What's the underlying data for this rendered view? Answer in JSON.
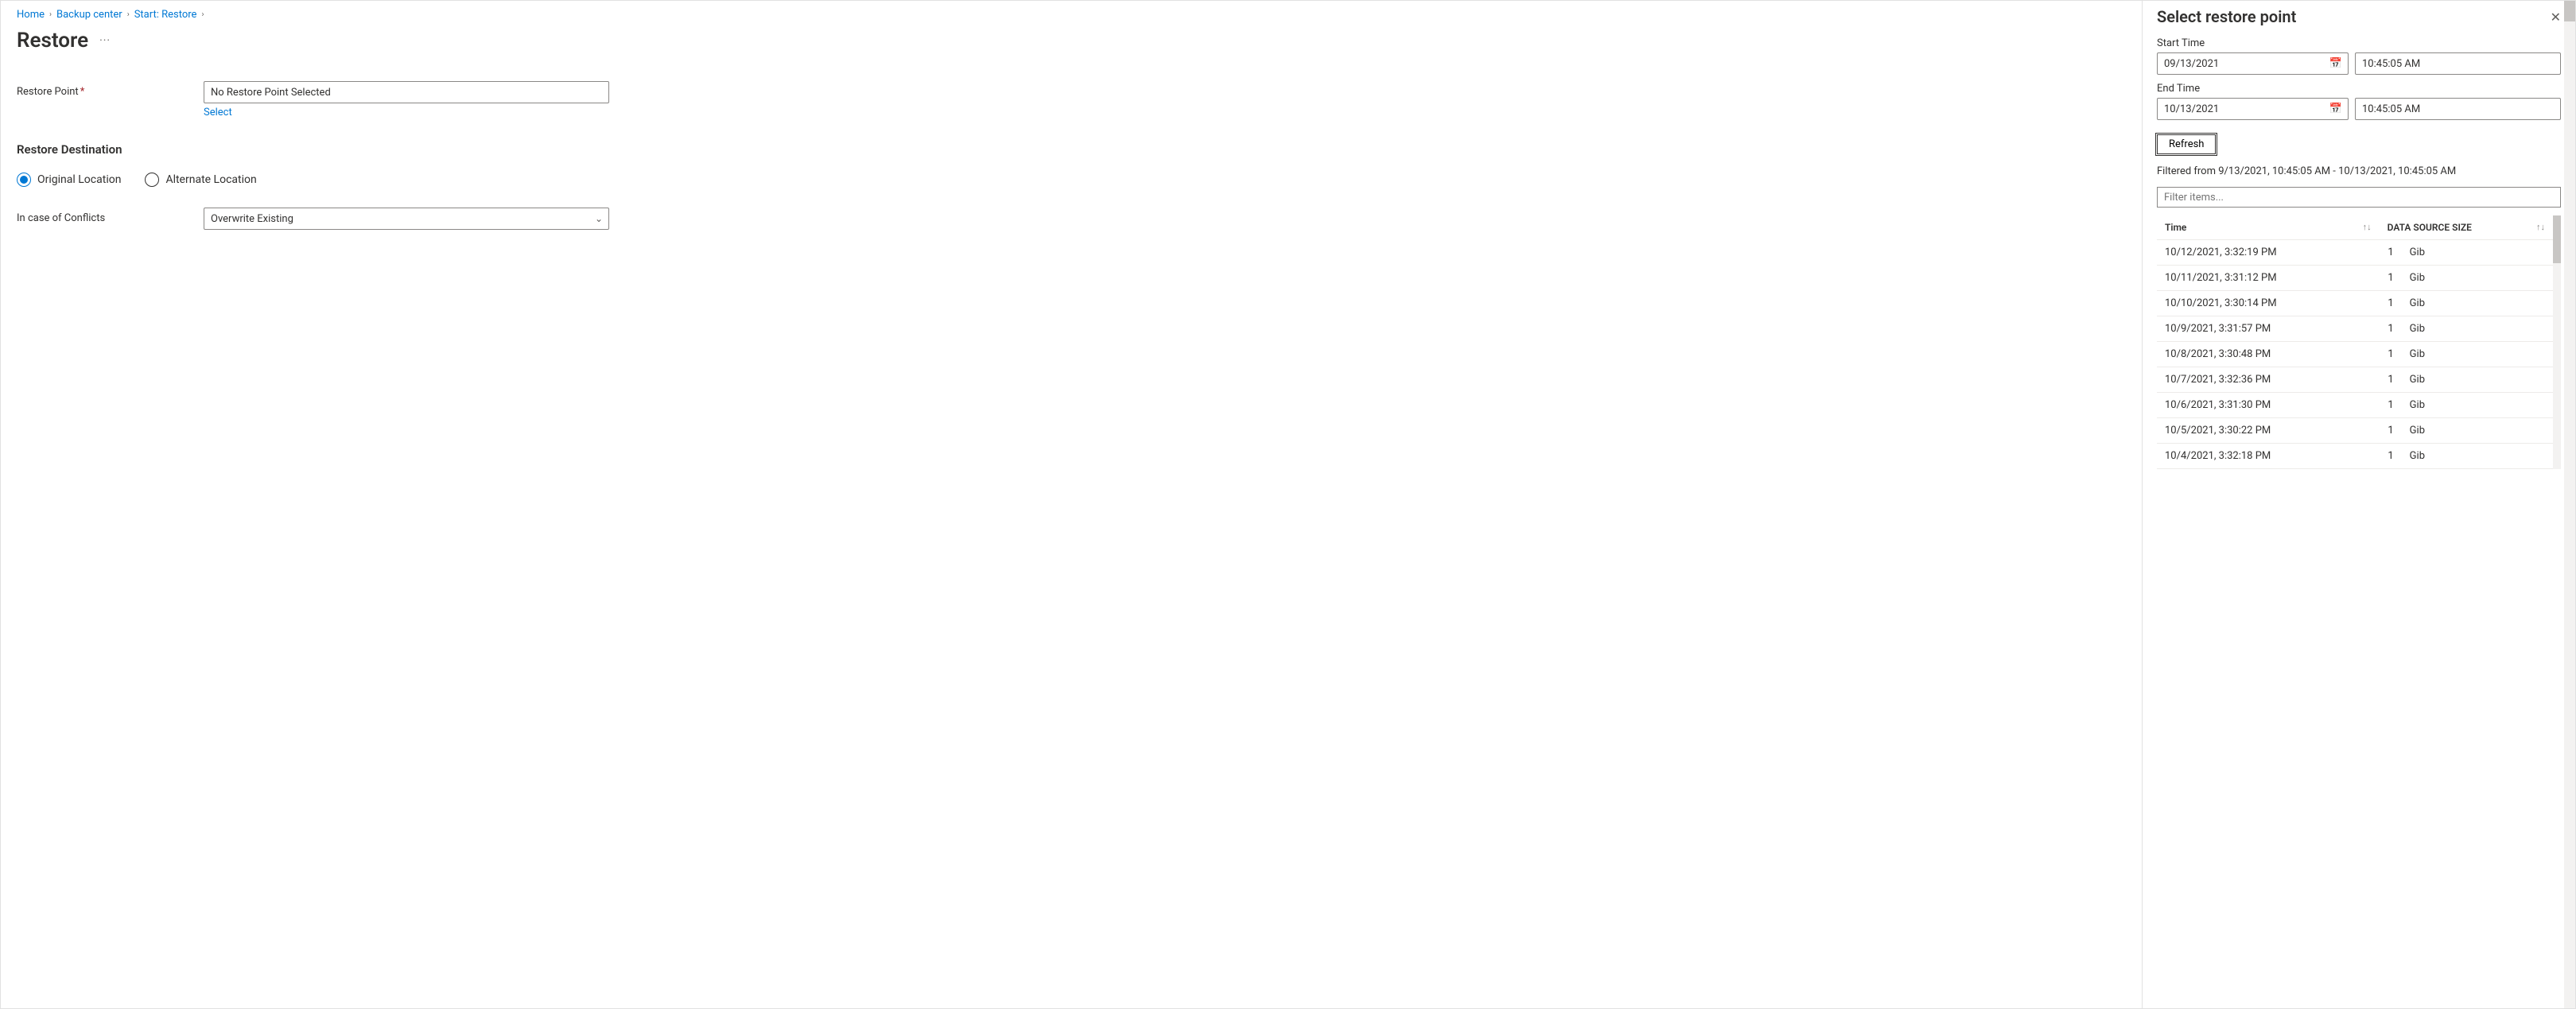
{
  "breadcrumb": {
    "items": [
      "Home",
      "Backup center",
      "Start: Restore"
    ]
  },
  "page": {
    "title": "Restore"
  },
  "form": {
    "restorePoint": {
      "label": "Restore Point",
      "value": "No Restore Point Selected",
      "selectLink": "Select"
    },
    "destinationHeading": "Restore Destination",
    "destination": {
      "original": "Original Location",
      "alternate": "Alternate Location"
    },
    "conflicts": {
      "label": "In case of Conflicts",
      "value": "Overwrite Existing"
    }
  },
  "blade": {
    "title": "Select restore point",
    "startLabel": "Start Time",
    "startDate": "09/13/2021",
    "startTime": "10:45:05 AM",
    "endLabel": "End Time",
    "endDate": "10/13/2021",
    "endTime": "10:45:05 AM",
    "refresh": "Refresh",
    "filteredText": "Filtered from 9/13/2021, 10:45:05 AM - 10/13/2021, 10:45:05 AM",
    "filterPlaceholder": "Filter items...",
    "columns": {
      "time": "Time",
      "size": "DATA SOURCE SIZE"
    },
    "rows": [
      {
        "time": "10/12/2021, 3:32:19 PM",
        "num": "1",
        "unit": "Gib"
      },
      {
        "time": "10/11/2021, 3:31:12 PM",
        "num": "1",
        "unit": "Gib"
      },
      {
        "time": "10/10/2021, 3:30:14 PM",
        "num": "1",
        "unit": "Gib"
      },
      {
        "time": "10/9/2021, 3:31:57 PM",
        "num": "1",
        "unit": "Gib"
      },
      {
        "time": "10/8/2021, 3:30:48 PM",
        "num": "1",
        "unit": "Gib"
      },
      {
        "time": "10/7/2021, 3:32:36 PM",
        "num": "1",
        "unit": "Gib"
      },
      {
        "time": "10/6/2021, 3:31:30 PM",
        "num": "1",
        "unit": "Gib"
      },
      {
        "time": "10/5/2021, 3:30:22 PM",
        "num": "1",
        "unit": "Gib"
      },
      {
        "time": "10/4/2021, 3:32:18 PM",
        "num": "1",
        "unit": "Gib"
      }
    ]
  }
}
